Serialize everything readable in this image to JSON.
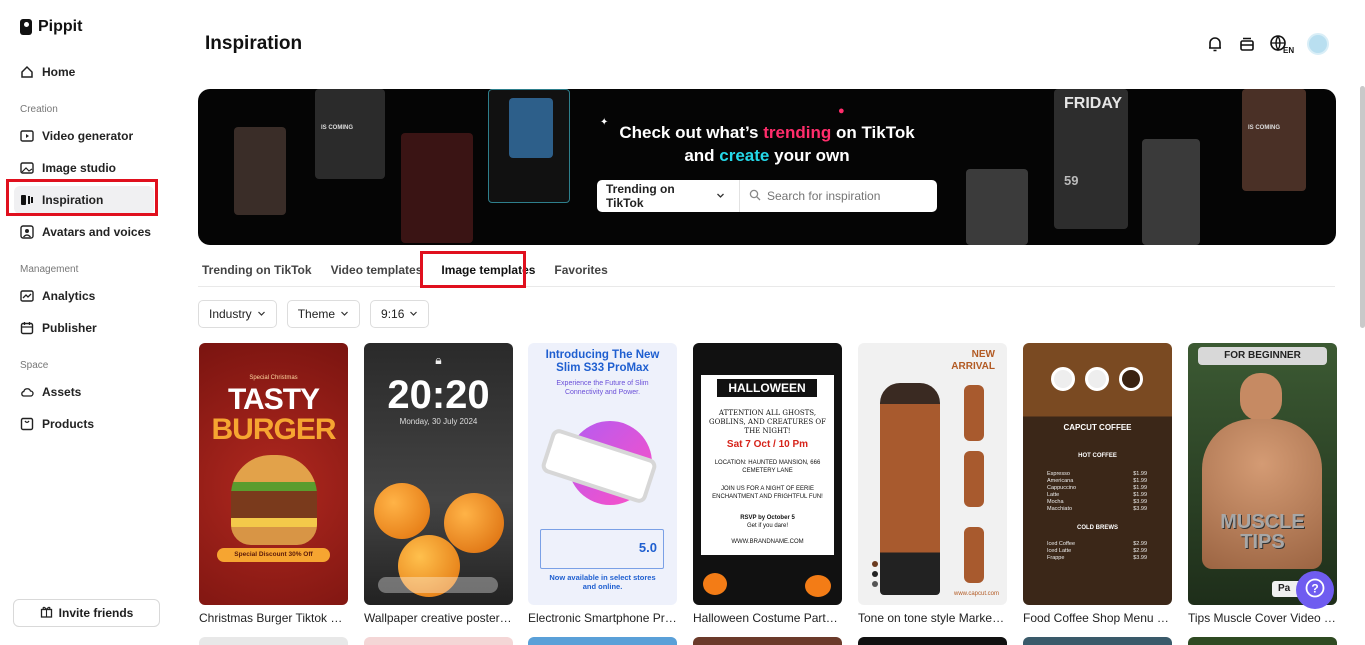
{
  "app": {
    "name": "Pippit"
  },
  "sidebar": {
    "home": "Home",
    "sections": [
      {
        "label": "Creation",
        "items": [
          "Video generator",
          "Image studio",
          "Inspiration",
          "Avatars and voices"
        ]
      },
      {
        "label": "Management",
        "items": [
          "Analytics",
          "Publisher"
        ]
      },
      {
        "label": "Space",
        "items": [
          "Assets",
          "Products"
        ]
      }
    ],
    "invite": "Invite friends"
  },
  "header": {
    "title": "Inspiration",
    "language": "EN"
  },
  "banner": {
    "line1_pre": "Check out what’s ",
    "line1_em": "trending",
    "line1_post": " on TikTok",
    "line2_pre": "and ",
    "line2_em": "create",
    "line2_post": " your own",
    "select_label": "Trending on TikTok",
    "search_placeholder": "Search for inspiration",
    "poster_texts": [
      "IS COMING",
      "FRIDAY",
      "IS COMING",
      "59"
    ]
  },
  "tabs": [
    "Trending on TikTok",
    "Video templates",
    "Image templates",
    "Favorites"
  ],
  "filters": [
    "Industry",
    "Theme",
    "9:16"
  ],
  "cards": [
    {
      "title": "Christmas Burger Tiktok Po...",
      "lines": [
        "Special Christmas",
        "TASTY",
        "BURGER",
        "Special Discount 30% Off"
      ]
    },
    {
      "title": "Wallpaper creative poster I...",
      "lines": [
        "20:20",
        "Monday, 30 July 2024"
      ]
    },
    {
      "title": "Electronic Smartphone Pro...",
      "lines": [
        "Introducing The New Slim S33 ProMax",
        "Experience the Future of Slim Connectivity and Power.",
        "5.0",
        "Now available in select stores and online."
      ]
    },
    {
      "title": "Halloween Costume Party I...",
      "lines": [
        "HALLOWEEN",
        "ATTENTION ALL GHOSTS, GOBLINS, AND CREATURES OF THE NIGHT!",
        "Sat 7 Oct / 10 Pm",
        "LOCATION: HAUNTED MANSION, 666 CEMETERY LANE",
        "JOIN US FOR A NIGHT OF EERIE ENCHANTMENT AND FRIGHTFUL FUN!",
        "RSVP by October 5",
        "Get if you dare!",
        "WWW.BRANDNAME.COM"
      ]
    },
    {
      "title": "Tone on tone style Marketi...",
      "lines": [
        "NEW",
        "ARRIVAL",
        "www.capcut.com"
      ]
    },
    {
      "title": "Food Coffee Shop Menu In...",
      "lines": [
        "CAPCUT COFFEE",
        "HOT COFFEE",
        "COLD BREWS"
      ],
      "hot": [
        [
          "Espresso",
          "$1.99"
        ],
        [
          "Americana",
          "$1.99"
        ],
        [
          "Cappuccino",
          "$1.99"
        ],
        [
          "Latte",
          "$1.99"
        ],
        [
          "Mocha",
          "$3.99"
        ],
        [
          "Macchiato",
          "$3.99"
        ]
      ],
      "cold": [
        [
          "Iced Coffee",
          "$2.99"
        ],
        [
          "Iced Latte",
          "$2.99"
        ],
        [
          "Frappe",
          "$3.99"
        ]
      ]
    },
    {
      "title": "Tips Muscle Cover Video Ti...",
      "lines": [
        "FOR BEGINNER",
        "MUSCLE",
        "TIPS",
        "Pa"
      ]
    }
  ],
  "help": "?"
}
